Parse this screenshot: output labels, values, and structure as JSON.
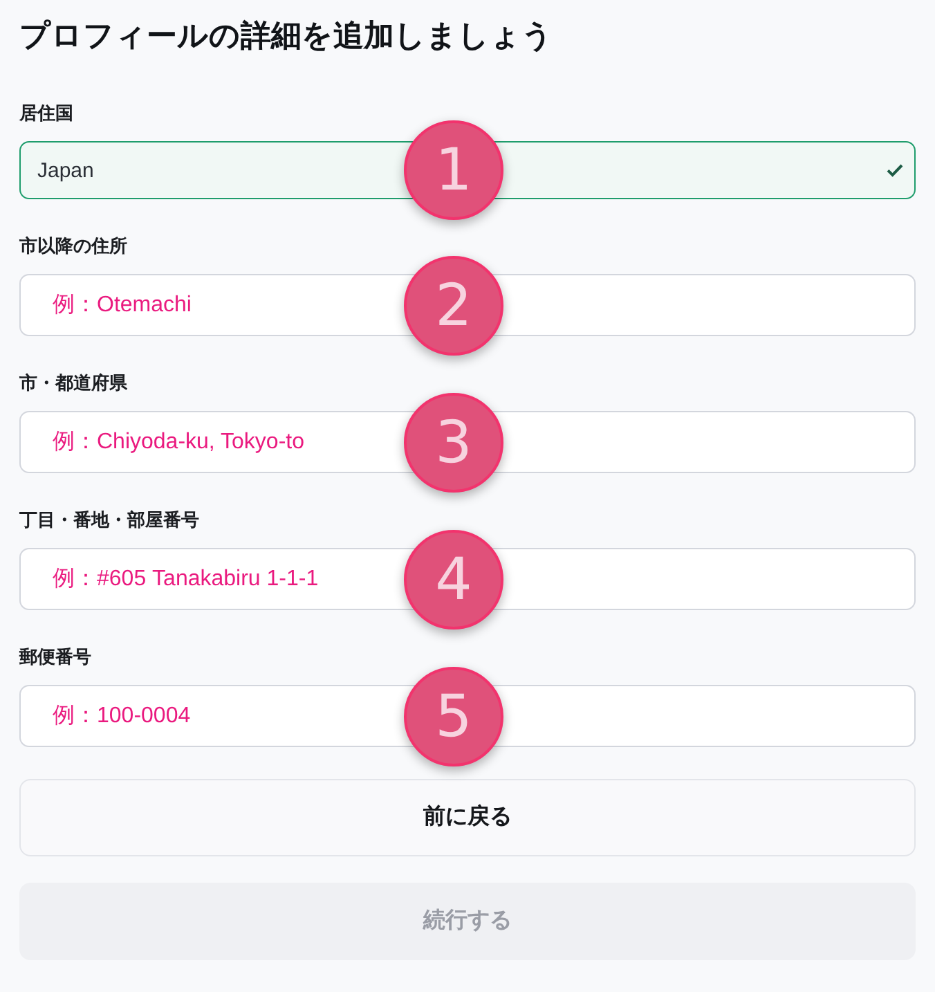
{
  "title": "プロフィールの詳細を追加しましょう",
  "fields": [
    {
      "label": "居住国",
      "value": "Japan",
      "valid": true,
      "marker": "1"
    },
    {
      "label": "市以降の住所",
      "placeholder": "例：Otemachi",
      "valid": false,
      "marker": "2"
    },
    {
      "label": "市・都道府県",
      "placeholder": "例：Chiyoda-ku, Tokyo-to",
      "valid": false,
      "marker": "3"
    },
    {
      "label": "丁目・番地・部屋番号",
      "placeholder": "例：#605 Tanakabiru 1-1-1",
      "valid": false,
      "marker": "4"
    },
    {
      "label": "郵便番号",
      "placeholder": "例：100-0004",
      "valid": false,
      "marker": "5"
    }
  ],
  "buttons": [
    {
      "label": "前に戻る",
      "disabled": false
    },
    {
      "label": "続行する",
      "disabled": true
    }
  ]
}
